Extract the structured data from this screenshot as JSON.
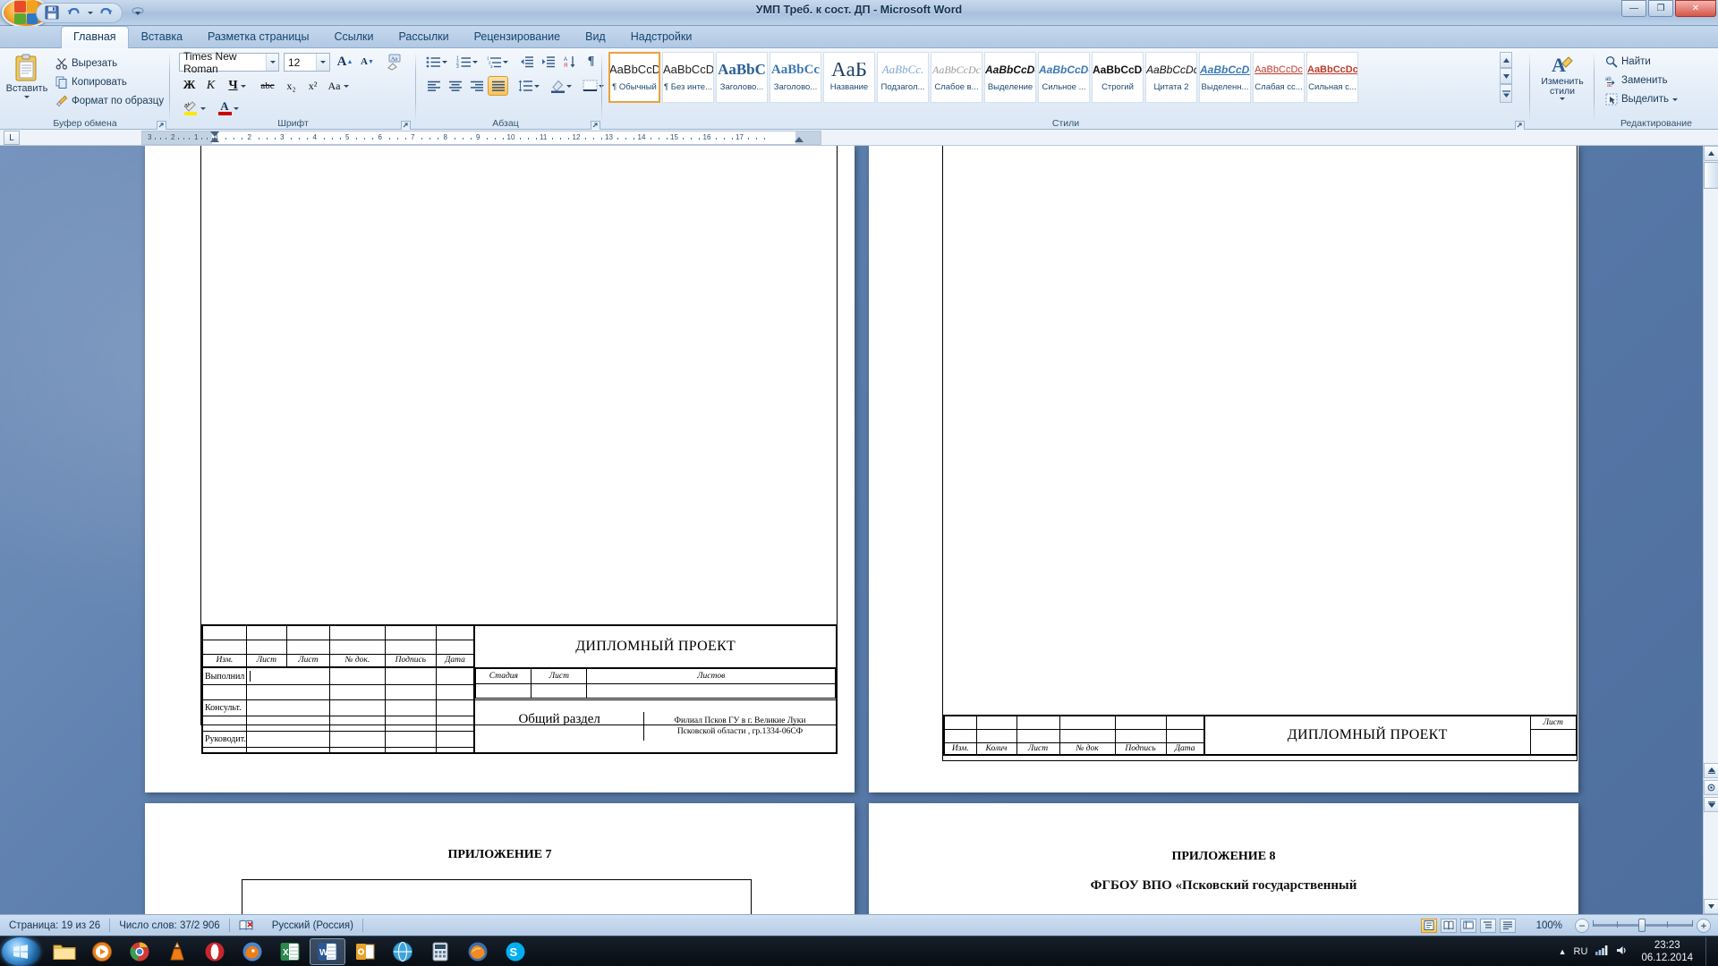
{
  "window": {
    "title": "УМП Треб. к сост. ДП  -  Microsoft Word",
    "minimize": "—",
    "maximize": "❐",
    "close": "✕",
    "office_button_tooltip": "Office",
    "quick_access": [
      {
        "name": "save-icon",
        "glyph": "save"
      },
      {
        "name": "undo-icon",
        "glyph": "undo"
      },
      {
        "name": "undo-dropdown-icon",
        "glyph": "caret"
      },
      {
        "name": "redo-icon",
        "glyph": "redo"
      },
      {
        "name": "customize-qat-icon",
        "glyph": "caret-round"
      }
    ]
  },
  "ribbon": {
    "tabs": [
      {
        "label": "Главная",
        "active": true
      },
      {
        "label": "Вставка",
        "active": false
      },
      {
        "label": "Разметка страницы",
        "active": false
      },
      {
        "label": "Ссылки",
        "active": false
      },
      {
        "label": "Рассылки",
        "active": false
      },
      {
        "label": "Рецензирование",
        "active": false
      },
      {
        "label": "Вид",
        "active": false
      },
      {
        "label": "Надстройки",
        "active": false
      }
    ],
    "groups": {
      "clipboard": {
        "label": "Буфер обмена",
        "paste": "Вставить",
        "cut": "Вырезать",
        "copy": "Копировать",
        "format_painter": "Формат по образцу"
      },
      "font": {
        "label": "Шрифт",
        "font_name": "Times New Roman",
        "font_size": "12",
        "grow": "A",
        "shrink": "A",
        "clear_format": "Aa",
        "bold": "Ж",
        "italic": "К",
        "underline": "Ч",
        "strike": "abc",
        "subscript": "x₂",
        "superscript": "x²",
        "change_case": "Aa",
        "highlight": "ab",
        "font_color": "A"
      },
      "paragraph": {
        "label": "Абзац",
        "bullets": "bullets",
        "numbering": "numbering",
        "multilevel": "multilevel",
        "decrease_indent": "decrease-indent",
        "increase_indent": "increase-indent",
        "sort": "sort",
        "show_marks": "¶",
        "align_left": "align-left",
        "align_center": "align-center",
        "align_right": "align-right",
        "align_justify": "align-justify",
        "line_spacing": "line-spacing",
        "shading": "shading",
        "borders": "borders"
      },
      "styles": {
        "label": "Стили",
        "change_styles": "Изменить\nстили",
        "change_styles_line1": "Изменить",
        "change_styles_line2": "стили",
        "gallery": [
          {
            "preview": "AaBbCcDc",
            "name": "¶ Обычный",
            "selected": true,
            "kind": "normal"
          },
          {
            "preview": "AaBbCcDc",
            "name": "¶ Без инте...",
            "selected": false,
            "kind": "normal"
          },
          {
            "preview": "AaBbC",
            "name": "Заголово...",
            "selected": false,
            "kind": "h1"
          },
          {
            "preview": "AaBbCc",
            "name": "Заголово...",
            "selected": false,
            "kind": "h2"
          },
          {
            "preview": "AaБ",
            "name": "Название",
            "selected": false,
            "kind": "title"
          },
          {
            "preview": "AaBbCc.",
            "name": "Подзагол...",
            "selected": false,
            "kind": "subtitle"
          },
          {
            "preview": "AaBbCcDc",
            "name": "Слабое в...",
            "selected": false,
            "kind": "weakem"
          },
          {
            "preview": "AaBbCcDc",
            "name": "Выделение",
            "selected": false,
            "kind": "em"
          },
          {
            "preview": "AaBbCcDc",
            "name": "Сильное ...",
            "selected": false,
            "kind": "strongem"
          },
          {
            "preview": "AaBbCcDc",
            "name": "Строгий",
            "selected": false,
            "kind": "strong"
          },
          {
            "preview": "AaBbCcDc",
            "name": "Цитата 2",
            "selected": false,
            "kind": "quote"
          },
          {
            "preview": "AaBbCcDc",
            "name": "Выделенн...",
            "selected": false,
            "kind": "intensequote"
          },
          {
            "preview": "AaBbCcDc",
            "name": "Слабая сс...",
            "selected": false,
            "kind": "weakref"
          },
          {
            "preview": "AaBbCcDc",
            "name": "Сильная с...",
            "selected": false,
            "kind": "strongref"
          }
        ]
      },
      "editing": {
        "label": "Редактирование",
        "find": "Найти",
        "replace": "Заменить",
        "select": "Выделить"
      }
    }
  },
  "ruler": {
    "tab_selector": "L",
    "left_numbers": [
      "3",
      "2",
      "1"
    ],
    "numbers": [
      "1",
      "2",
      "3",
      "4",
      "5",
      "6",
      "7",
      "8",
      "9",
      "10",
      "11",
      "12",
      "13",
      "14",
      "15",
      "16",
      "17"
    ]
  },
  "document": {
    "pages": [
      {
        "id": "page-left",
        "title_block": {
          "main_title": "ДИПЛОМНЫЙ ПРОЕКТ",
          "section_title": "Общий раздел",
          "header_cells": [
            "Изм.",
            "Лист",
            "Лист",
            "№ док.",
            "Подпись",
            "Дата"
          ],
          "row_labels": [
            "Выполнил",
            "",
            "Консульт.",
            "",
            "Руководит."
          ],
          "stage_headers": [
            "Стадия",
            "Лист",
            "Листов"
          ],
          "org_line1": "Филиал Псков ГУ в г. Великие Луки",
          "org_line2": "Псковской области , гр.1334-06СФ"
        }
      },
      {
        "id": "page-right",
        "title_block": {
          "main_title": "ДИПЛОМНЫЙ ПРОЕКТ",
          "header_cells": [
            "Изм.",
            "Колич",
            "Лист",
            "№ док",
            "Подпись",
            "Дата"
          ],
          "sheet_label": "Лист"
        }
      }
    ],
    "next_pages": [
      {
        "id": "page-left-2",
        "heading": "ПРИЛОЖЕНИЕ 7"
      },
      {
        "id": "page-right-2",
        "heading": "ПРИЛОЖЕНИЕ 8",
        "subtext": "ФГБОУ ВПО «Псковский государственный"
      }
    ]
  },
  "status_bar": {
    "page": "Страница: 19 из 26",
    "words": "Число слов: 37/2 906",
    "proofing_icon": "proofing-errors-icon",
    "language": "Русский (Россия)",
    "views": [
      "print-layout",
      "full-screen-reading",
      "web-layout",
      "outline",
      "draft"
    ],
    "zoom": "100%",
    "zoom_out": "−",
    "zoom_in": "+"
  },
  "taskbar": {
    "start": "start-orb",
    "items": [
      {
        "name": "explorer-icon",
        "glyph": "folder"
      },
      {
        "name": "media-player-icon",
        "glyph": "wmp"
      },
      {
        "name": "chrome-icon",
        "glyph": "chrome"
      },
      {
        "name": "vlc-icon",
        "glyph": "vlc"
      },
      {
        "name": "opera-icon",
        "glyph": "opera"
      },
      {
        "name": "firefox-fox-icon",
        "glyph": "fox"
      },
      {
        "name": "excel-icon",
        "glyph": "excel"
      },
      {
        "name": "word-icon",
        "glyph": "word",
        "active": true
      },
      {
        "name": "outlook-icon",
        "glyph": "outlook"
      },
      {
        "name": "browser-icon",
        "glyph": "browser"
      },
      {
        "name": "calculator-icon",
        "glyph": "calc"
      },
      {
        "name": "firefox-icon",
        "glyph": "firefox"
      },
      {
        "name": "skype-icon",
        "glyph": "skype"
      }
    ],
    "tray": {
      "language": "RU",
      "show_hidden": "▲",
      "network_icon": "network-icon",
      "volume_icon": "volume-icon",
      "time": "23:23",
      "date": "06.12.2014"
    }
  }
}
